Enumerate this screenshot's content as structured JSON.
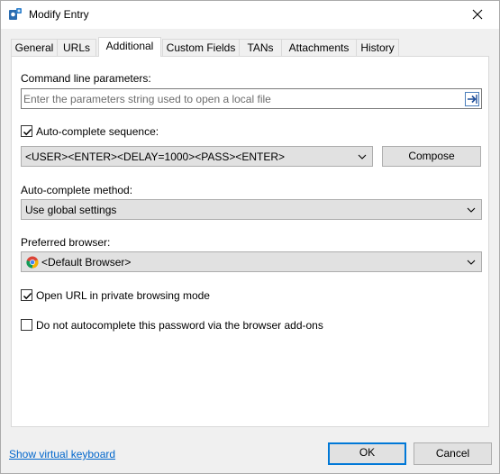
{
  "window": {
    "title": "Modify Entry"
  },
  "tabs": [
    {
      "label": "General",
      "active": false
    },
    {
      "label": "URLs",
      "active": false
    },
    {
      "label": "Additional",
      "active": true
    },
    {
      "label": "Custom Fields",
      "active": false
    },
    {
      "label": "TANs",
      "active": false
    },
    {
      "label": "Attachments",
      "active": false
    },
    {
      "label": "History",
      "active": false
    }
  ],
  "command_line": {
    "label": "Command line parameters:",
    "placeholder": "Enter the parameters string used to open a local file",
    "value": ""
  },
  "autocomplete_sequence": {
    "checkbox_label": "Auto-complete sequence:",
    "checked": true,
    "value": "<USER><ENTER><DELAY=1000><PASS><ENTER>",
    "compose_label": "Compose"
  },
  "autocomplete_method": {
    "label": "Auto-complete method:",
    "value": "Use global settings"
  },
  "preferred_browser": {
    "label": "Preferred browser:",
    "value": "<Default Browser>"
  },
  "private_mode": {
    "label": "Open URL in private browsing mode",
    "checked": true
  },
  "no_autocomplete": {
    "label": "Do not autocomplete this password via the browser add-ons",
    "checked": false
  },
  "footer": {
    "keyboard_link": "Show virtual keyboard",
    "ok_label": "OK",
    "cancel_label": "Cancel"
  },
  "colors": {
    "accent": "#0078d7",
    "link": "#0066cc"
  }
}
